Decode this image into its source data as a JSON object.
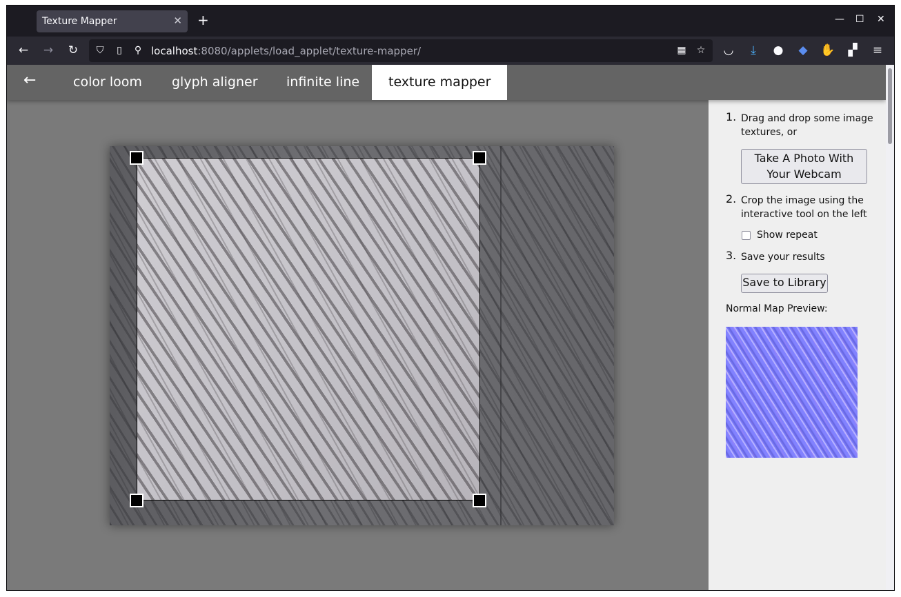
{
  "browser": {
    "tab_title": "Texture Mapper",
    "tab_close": "✕",
    "new_tab": "+",
    "window_controls": {
      "minimize": "—",
      "maximize": "☐",
      "close": "✕"
    },
    "url_host": "localhost",
    "url_rest": ":8080/applets/load_applet/texture-mapper/",
    "nav_icons": [
      "back-icon",
      "forward-icon",
      "reload-icon",
      "shield-icon",
      "page-icon",
      "permissions-icon",
      "qr-icon",
      "bookmark-star-icon",
      "pocket-icon",
      "download-icon",
      "extension-s-icon",
      "extension-cap-icon",
      "extension-gnome-icon",
      "extensions-icon",
      "menu-icon"
    ]
  },
  "app": {
    "back_label": "←",
    "tabs": [
      {
        "label": "color loom",
        "active": false
      },
      {
        "label": "glyph aligner",
        "active": false
      },
      {
        "label": "infinite line",
        "active": false
      },
      {
        "label": "texture mapper",
        "active": true
      }
    ]
  },
  "panel": {
    "step1_num": "1.",
    "step1_text": "Drag and drop some image textures, or",
    "webcam_button": "Take A Photo With Your Webcam",
    "step2_num": "2.",
    "step2_text": "Crop the image using the interactive tool on the left",
    "show_repeat_label": "Show repeat",
    "show_repeat_checked": false,
    "step3_num": "3.",
    "step3_text": "Save your results",
    "save_button": "Save to Library",
    "normal_map_label": "Normal Map Preview:"
  },
  "colors": {
    "app_nav_bg": "#646464",
    "stage_bg": "#7a7a7a",
    "panel_bg": "#efefef",
    "normal_map_base": "#8282ff"
  }
}
